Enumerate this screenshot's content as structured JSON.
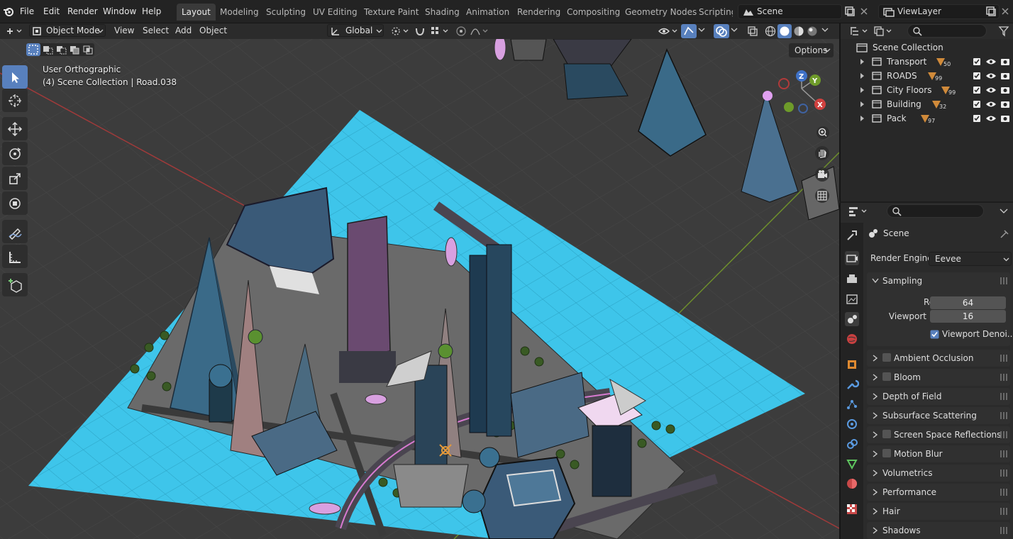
{
  "menu": [
    "File",
    "Edit",
    "Render",
    "Window",
    "Help"
  ],
  "workspaces": [
    "Layout",
    "Modeling",
    "Sculpting",
    "UV Editing",
    "Texture Paint",
    "Shading",
    "Animation",
    "Rendering",
    "Compositing",
    "Geometry Nodes",
    "Scripting"
  ],
  "scene_field": "Scene",
  "viewlayer_field": "ViewLayer",
  "header": {
    "mode": "Object Mode",
    "view": "View",
    "select": "Select",
    "add": "Add",
    "object": "Object",
    "transform_orientation": "Global",
    "options": "Options"
  },
  "viewport": {
    "view_name": "User Orthographic",
    "collection_info": "(4) Scene Collection | Road.038"
  },
  "gizmo": {
    "z": "Z",
    "y": "Y",
    "x": "X"
  },
  "outliner": {
    "root": "Scene Collection",
    "items": [
      {
        "label": "Transport",
        "count": "50"
      },
      {
        "label": "ROADS",
        "count": "99"
      },
      {
        "label": "City Floors",
        "count": "99"
      },
      {
        "label": "Building",
        "count": "32"
      },
      {
        "label": "Pack",
        "count": "97"
      }
    ]
  },
  "properties": {
    "title": "Scene",
    "render_engine_label": "Render Engine",
    "render_engine_value": "Eevee",
    "sampling": {
      "label": "Sampling",
      "render_label": "Render",
      "render_value": "64",
      "viewport_label": "Viewport",
      "viewport_value": "16",
      "denoise_label": "Viewport Denoi..."
    },
    "panels": [
      {
        "label": "Ambient Occlusion",
        "checkbox": true
      },
      {
        "label": "Bloom",
        "checkbox": true
      },
      {
        "label": "Depth of Field",
        "checkbox": false
      },
      {
        "label": "Subsurface Scattering",
        "checkbox": false
      },
      {
        "label": "Screen Space Reflections",
        "checkbox": true
      },
      {
        "label": "Motion Blur",
        "checkbox": true
      },
      {
        "label": "Volumetrics",
        "checkbox": false
      },
      {
        "label": "Performance",
        "checkbox": false
      },
      {
        "label": "Hair",
        "checkbox": false
      },
      {
        "label": "Shadows",
        "checkbox": false
      }
    ]
  },
  "colors": {
    "accent": "#5880bd",
    "ground": "#3ec5ea",
    "selection": "#e59a3b"
  }
}
